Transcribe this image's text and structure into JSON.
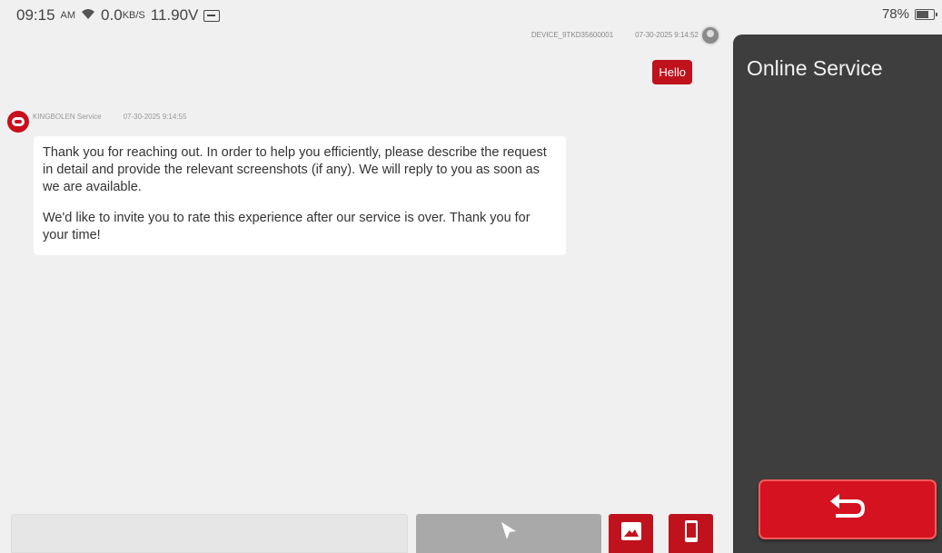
{
  "status_bar": {
    "time": "09:15",
    "ampm": "AM",
    "network_speed": "0.0",
    "network_unit": "KB/S",
    "voltage": "11.90V",
    "battery_percent": "78%"
  },
  "chat": {
    "user_message": {
      "sender": "DEVICE_9TKD35600001",
      "timestamp": "07-30-2025 9:14:52",
      "text": "Hello"
    },
    "service_message": {
      "sender": "KINGBOLEN Service",
      "timestamp": "07-30-2025 9:14:55",
      "paragraph1": "Thank you for reaching out. In order to help you efficiently, please describe the request in detail and provide the relevant screenshots (if any). We will reply to you as soon as we are available.",
      "paragraph2": "We'd like to invite you to rate this experience after our service is over. Thank you for your time!"
    }
  },
  "input": {
    "placeholder": ""
  },
  "side_panel": {
    "title": "Online Service"
  },
  "colors": {
    "accent_red": "#c0121d",
    "panel_dark": "#3e3e3e"
  },
  "icons": {
    "wifi": "wifi-icon",
    "voltage": "battery-voltage-icon",
    "battery": "battery-icon",
    "send": "send-cursor-icon",
    "image": "image-icon",
    "phone": "phone-icon",
    "back": "back-arrow-icon"
  }
}
